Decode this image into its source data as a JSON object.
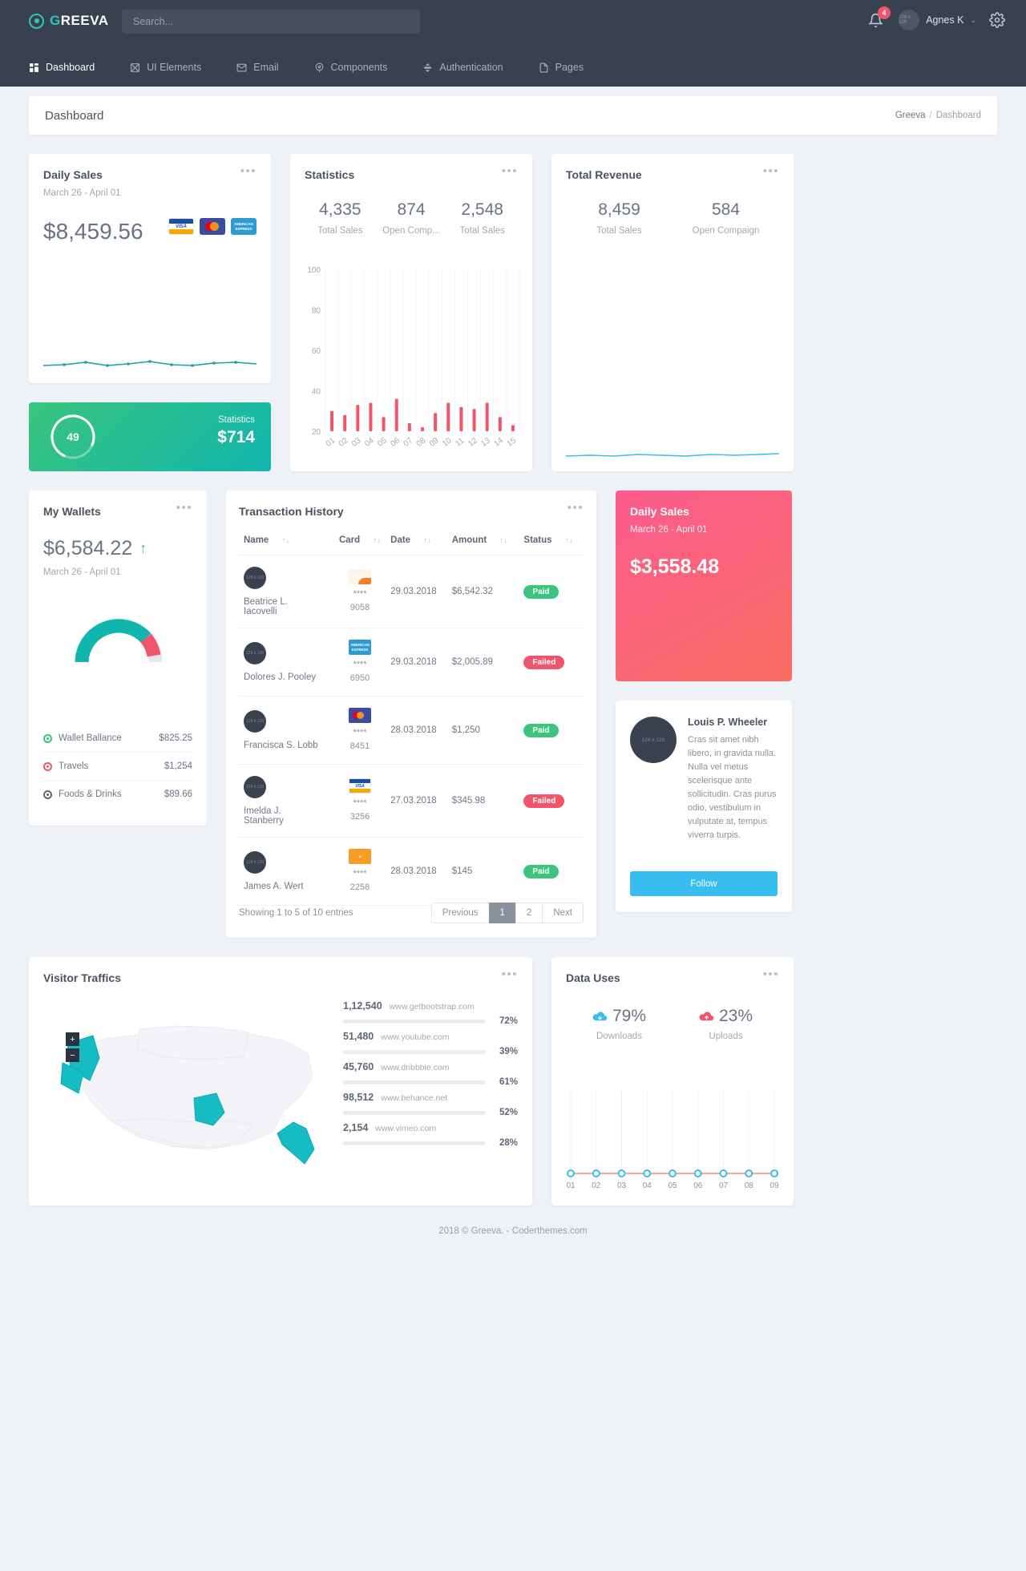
{
  "topbar": {
    "logo_g": "G",
    "logo_rest": "REEVA",
    "search_placeholder": "Search...",
    "notification_count": "4",
    "user_name": "Agnes K",
    "caret": "⌄",
    "avatar_label": "128 x 128"
  },
  "nav": [
    {
      "label": "Dashboard",
      "icon": "grid-icon",
      "active": true
    },
    {
      "label": "UI Elements",
      "icon": "layers-icon",
      "active": false
    },
    {
      "label": "Email",
      "icon": "mail-icon",
      "active": false
    },
    {
      "label": "Components",
      "icon": "compass-icon",
      "active": false
    },
    {
      "label": "Authentication",
      "icon": "lock-icon",
      "active": false
    },
    {
      "label": "Pages",
      "icon": "file-icon",
      "active": false
    }
  ],
  "page": {
    "title": "Dashboard",
    "crumb_root": "Greeva",
    "crumb_sep": "/",
    "crumb_current": "Dashboard"
  },
  "daily_sales": {
    "title": "Daily Sales",
    "range": "March 26 - April 01",
    "amount": "$8,459.56",
    "cards": [
      {
        "name": "visa-card-icon",
        "text": "VISA"
      },
      {
        "name": "mastercard-icon",
        "text": ""
      },
      {
        "name": "amex-card-icon",
        "text": "AMERICAN EXPRESS"
      }
    ],
    "menu": "•••"
  },
  "green_card": {
    "gauge_value": "49",
    "gauge_percent": 74,
    "label": "Statistics",
    "amount": "$714"
  },
  "statistics": {
    "title": "Statistics",
    "menu": "•••",
    "kpis": [
      {
        "value": "4,335",
        "label": "Total Sales"
      },
      {
        "value": "874",
        "label": "Open Comp..."
      },
      {
        "value": "2,548",
        "label": "Total Sales"
      }
    ]
  },
  "total_revenue": {
    "title": "Total Revenue",
    "menu": "•••",
    "kpis": [
      {
        "value": "8,459",
        "label": "Total Sales"
      },
      {
        "value": "584",
        "label": "Open Compaign"
      }
    ]
  },
  "wallet": {
    "title": "My Wallets",
    "menu": "•••",
    "amount": "$6,584.22",
    "trend": "↑",
    "range": "March 26 - April 01",
    "items": [
      {
        "label": "Wallet Ballance",
        "value": "$825.25",
        "color": "#3ac47d"
      },
      {
        "label": "Travels",
        "value": "$1,254",
        "color": "#f1556c"
      },
      {
        "label": "Foods & Drinks",
        "value": "$89.66",
        "color": "#5f6775"
      }
    ]
  },
  "transactions": {
    "title": "Transaction History",
    "menu": "•••",
    "columns": [
      "Name",
      "Card",
      "Date",
      "Amount",
      "Status"
    ],
    "sort_glyph": "↑↓",
    "rows": [
      {
        "avatar": "128 x 128",
        "name": "Beatrice L. Iacovelli",
        "card_brand": "discover",
        "card_brand_text": "DISC●VER",
        "stars": "****",
        "card_num": "9058",
        "date": "29.03.2018",
        "amount": "$6,542.32",
        "status": "Paid",
        "status_kind": "paid"
      },
      {
        "avatar": "128 x 128",
        "name": "Dolores J. Pooley",
        "card_brand": "amex",
        "card_brand_text": "AMERICAN EXPRESS",
        "stars": "****",
        "card_num": "6950",
        "date": "29.03.2018",
        "amount": "$2,005.89",
        "status": "Failed",
        "status_kind": "failed"
      },
      {
        "avatar": "128 x 128",
        "name": "Francisca S. Lobb",
        "card_brand": "mastercard",
        "card_brand_text": "",
        "stars": "****",
        "card_num": "8451",
        "date": "28.03.2018",
        "amount": "$1,250",
        "status": "Paid",
        "status_kind": "paid"
      },
      {
        "avatar": "128 x 128",
        "name": "Imelda J. Stanberry",
        "card_brand": "visa",
        "card_brand_text": "VISA",
        "stars": "****",
        "card_num": "3256",
        "date": "27.03.2018",
        "amount": "$345.98",
        "status": "Failed",
        "status_kind": "failed"
      },
      {
        "avatar": "128 x 128",
        "name": "James A. Wert",
        "card_brand": "amazon",
        "card_brand_text": "a",
        "stars": "****",
        "card_num": "2258",
        "date": "28.03.2018",
        "amount": "$145",
        "status": "Paid",
        "status_kind": "paid"
      }
    ],
    "entries": "Showing 1 to 5 of 10 entries",
    "pager": [
      "Previous",
      "1",
      "2",
      "Next"
    ],
    "pager_active": "1"
  },
  "daily_sales_pink": {
    "title": "Daily Sales",
    "range": "March 26 - April 01",
    "amount": "$3,558.48"
  },
  "profile": {
    "avatar": "128 x 128",
    "name": "Louis P. Wheeler",
    "text": "Cras sit amet nibh libero, in gravida nulla. Nulla vel metus scelerisque ante sollicitudin. Cras purus odio, vestibulum in vulputate at, tempus viverra turpis.",
    "button": "Follow"
  },
  "visitor": {
    "title": "Visitor Traffics",
    "menu": "•••",
    "zoom_in": "+",
    "zoom_out": "−",
    "rows": [
      {
        "count": "1,12,540",
        "site": "www.getbootstrap.com",
        "pct": "72%",
        "value": 72,
        "color": "#2b87d6"
      },
      {
        "count": "51,480",
        "site": "www.youtube.com",
        "pct": "39%",
        "value": 39,
        "color": "#35c27b"
      },
      {
        "count": "45,760",
        "site": "www.dribbble.com",
        "pct": "61%",
        "value": 61,
        "color": "#35b6d8"
      },
      {
        "count": "98,512",
        "site": "www.behance.net",
        "pct": "52%",
        "value": 52,
        "color": "#f5c249"
      },
      {
        "count": "2,154",
        "site": "www.vimeo.com",
        "pct": "28%",
        "value": 28,
        "color": "#e8453c"
      }
    ]
  },
  "data_uses": {
    "title": "Data Uses",
    "menu": "•••",
    "downloads": {
      "value": "79%",
      "label": "Downloads",
      "color": "#38bdf0",
      "icon": "cloud-download-icon"
    },
    "uploads": {
      "value": "23%",
      "label": "Uploads",
      "color": "#f1556c",
      "icon": "cloud-upload-icon"
    }
  },
  "footer": {
    "text": "2018 © Greeva. - Coderthemes.com"
  },
  "chart_data": [
    {
      "type": "bar",
      "title": "Statistics",
      "categories": [
        "01",
        "02",
        "03",
        "04",
        "05",
        "06",
        "07",
        "08",
        "09",
        "10",
        "11",
        "12",
        "13",
        "14",
        "15"
      ],
      "values": [
        30,
        28,
        33,
        34,
        27,
        36,
        24,
        22,
        29,
        34,
        32,
        31,
        34,
        27,
        23
      ],
      "ylim": [
        20,
        100
      ],
      "yticks": [
        20,
        40,
        60,
        80,
        100
      ],
      "grid": true,
      "color": "#f1556c",
      "xlabel": "",
      "ylabel": ""
    },
    {
      "type": "line",
      "title": "Daily Sales Sparkline",
      "x": [
        1,
        2,
        3,
        4,
        5,
        6,
        7,
        8,
        9,
        10
      ],
      "values": [
        3,
        5,
        2,
        4,
        6,
        3,
        2,
        4,
        5,
        4
      ],
      "color": "#17a2a2",
      "grid": false
    },
    {
      "type": "line",
      "title": "Total Revenue Sparkline",
      "x": [
        1,
        2,
        3,
        4,
        5,
        6,
        7,
        8,
        9,
        10
      ],
      "values": [
        2,
        3,
        2,
        4,
        3,
        2,
        3,
        4,
        3,
        5
      ],
      "color": "#38bdf0",
      "grid": false
    },
    {
      "type": "pie",
      "title": "My Wallets Gauge",
      "labels": [
        "Wallet Ballance",
        "Travels",
        "Foods & Drinks"
      ],
      "values": [
        60,
        25,
        15
      ],
      "colors": [
        "#10b6ae",
        "#f1556c",
        "#e4e8ed"
      ]
    },
    {
      "type": "line",
      "title": "Data Uses",
      "categories": [
        "01",
        "02",
        "03",
        "04",
        "05",
        "06",
        "07",
        "08",
        "09"
      ],
      "values": [
        1,
        1,
        1,
        1,
        1,
        1,
        1,
        1,
        1
      ],
      "color": "#f58a80",
      "grid": true
    },
    {
      "type": "bar",
      "title": "Visitor Traffics Sources",
      "categories": [
        "www.getbootstrap.com",
        "www.youtube.com",
        "www.dribbble.com",
        "www.behance.net",
        "www.vimeo.com"
      ],
      "values": [
        72,
        39,
        61,
        52,
        28
      ],
      "counts": [
        "1,12,540",
        "51,480",
        "45,760",
        "98,512",
        "2,154"
      ],
      "ylim": [
        0,
        100
      ]
    }
  ]
}
